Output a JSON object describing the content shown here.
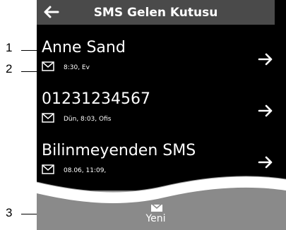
{
  "header": {
    "title": "SMS Gelen Kutusu",
    "back_icon": "arrow-left-icon"
  },
  "messages": [
    {
      "sender": "Anne Sand",
      "meta": "8:30, Ev"
    },
    {
      "sender": "01231234567",
      "meta": "Dün, 8:03, Ofis"
    },
    {
      "sender": "Bilinmeyenden SMS",
      "meta": "08.06, 11:09,"
    }
  ],
  "bottom": {
    "new_label": "Yeni",
    "new_icon": "new-message-icon"
  },
  "callouts": {
    "c1": "1",
    "c2": "2",
    "c3": "3"
  },
  "colors": {
    "header_bg": "#4a4a4a",
    "screen_bg": "#000000",
    "bottom_bg": "#8a8a8a"
  }
}
